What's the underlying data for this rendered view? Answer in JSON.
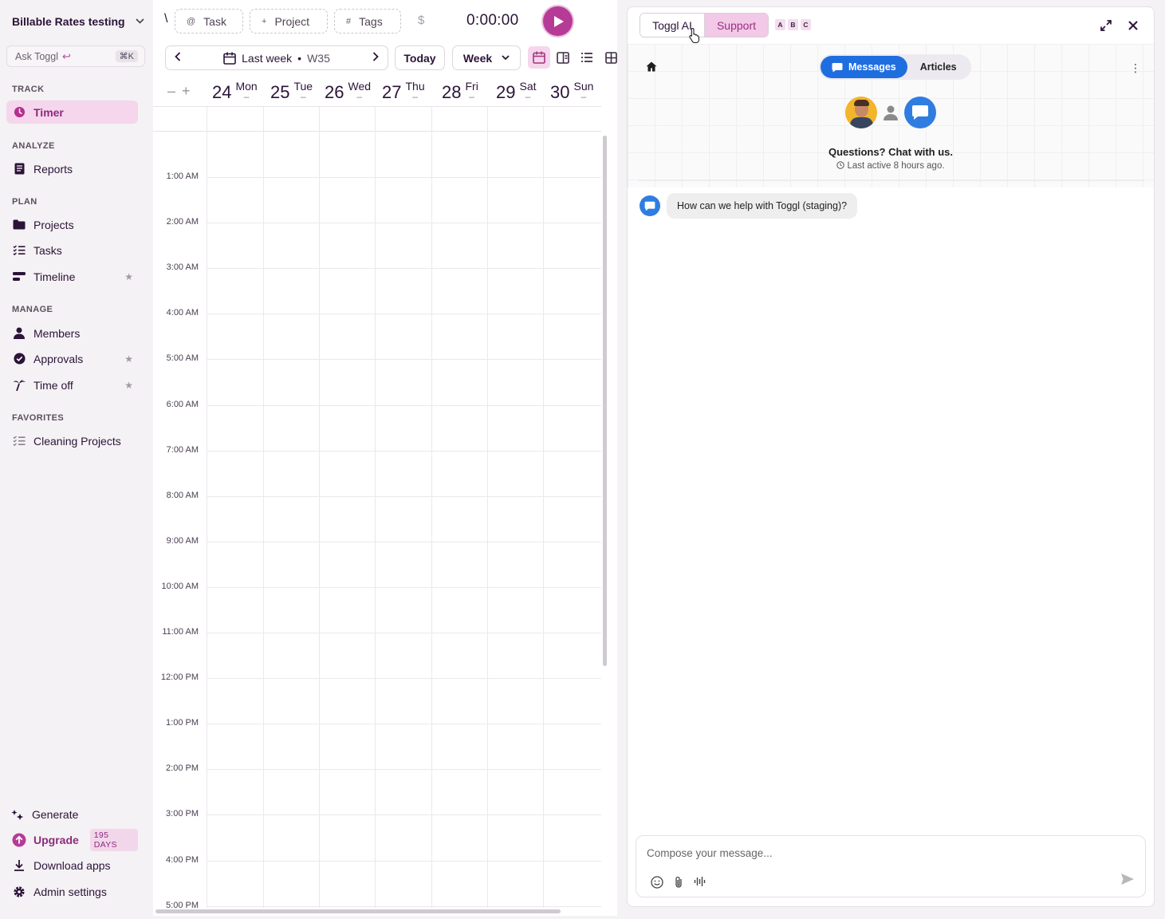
{
  "sidebar": {
    "workspace": "Billable Rates testing",
    "ask": {
      "label": "Ask Toggl",
      "shortcut": "⌘K"
    },
    "sections": {
      "track": "TRACK",
      "analyze": "ANALYZE",
      "plan": "PLAN",
      "manage": "MANAGE",
      "favorites": "FAVORITES"
    },
    "items": {
      "timer": "Timer",
      "reports": "Reports",
      "projects": "Projects",
      "tasks": "Tasks",
      "timeline": "Timeline",
      "members": "Members",
      "approvals": "Approvals",
      "timeoff": "Time off",
      "cleaning": "Cleaning Projects"
    },
    "bottom": {
      "generate": "Generate",
      "upgrade": "Upgrade",
      "upgrade_badge": "195 DAYS",
      "download": "Download apps",
      "admin": "Admin settings"
    }
  },
  "timerbar": {
    "slash": "\\",
    "task": "Task",
    "project": "Project",
    "tags": "Tags",
    "dollar": "$",
    "time": "0:00:00"
  },
  "calendar": {
    "range_label": "Last week",
    "week": "W35",
    "today": "Today",
    "view": "Week",
    "days": [
      {
        "num": "24",
        "name": "Mon"
      },
      {
        "num": "25",
        "name": "Tue"
      },
      {
        "num": "26",
        "name": "Wed"
      },
      {
        "num": "27",
        "name": "Thu"
      },
      {
        "num": "28",
        "name": "Fri"
      },
      {
        "num": "29",
        "name": "Sat"
      },
      {
        "num": "30",
        "name": "Sun"
      }
    ],
    "day_total": "–",
    "times": [
      "1:00 AM",
      "2:00 AM",
      "3:00 AM",
      "4:00 AM",
      "5:00 AM",
      "6:00 AM",
      "7:00 AM",
      "8:00 AM",
      "9:00 AM",
      "10:00 AM",
      "11:00 AM",
      "12:00 PM",
      "1:00 PM",
      "2:00 PM",
      "3:00 PM",
      "4:00 PM",
      "5:00 PM"
    ]
  },
  "panel": {
    "tab_ai": "Toggl AI",
    "tab_support": "Support",
    "abc": [
      "A",
      "B",
      "C"
    ],
    "messages_tab": "Messages",
    "articles_tab": "Articles",
    "question": "Questions? Chat with us.",
    "last_active": "Last active 8 hours ago.",
    "bot_message": "How can we help with Toggl (staging)?",
    "compose_placeholder": "Compose your message..."
  },
  "colors": {
    "accent": "#b63b96",
    "active_bg": "#f5d6ec",
    "intercom_blue": "#1f6ee0"
  }
}
